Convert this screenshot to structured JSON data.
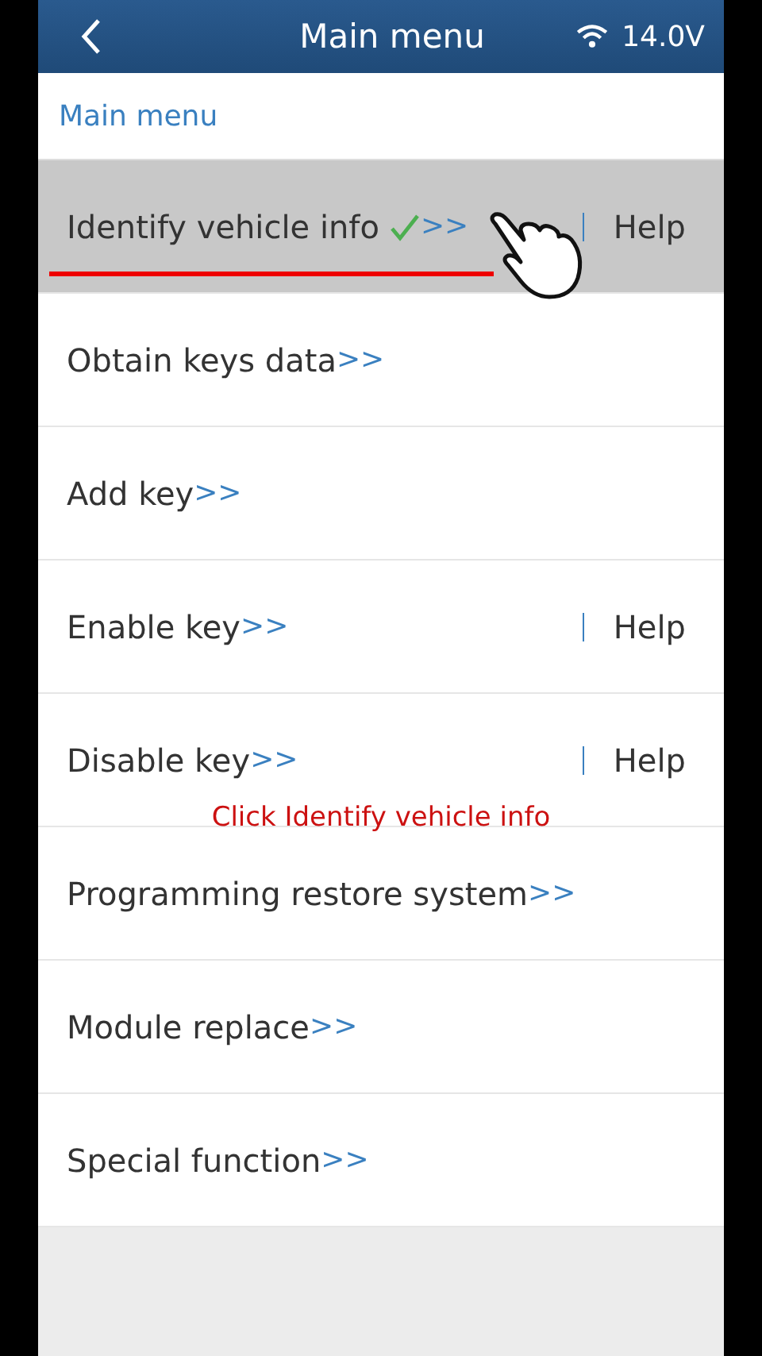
{
  "header": {
    "title": "Main menu",
    "voltage": "14.0V"
  },
  "breadcrumb": "Main menu",
  "items": [
    {
      "label": "Identify vehicle info",
      "arrow": ">>",
      "help": "Help",
      "selected": true,
      "checked": true
    },
    {
      "label": "Obtain keys data",
      "arrow": ">>",
      "selected": false,
      "checked": false
    },
    {
      "label": "Add key",
      "arrow": ">>",
      "selected": false,
      "checked": false
    },
    {
      "label": "Enable key",
      "arrow": ">>",
      "help": "Help",
      "selected": false,
      "checked": false
    },
    {
      "label": "Disable key",
      "arrow": ">>",
      "help": "Help",
      "selected": false,
      "checked": false
    },
    {
      "label": "Programming restore system",
      "arrow": ">>",
      "selected": false,
      "checked": false
    },
    {
      "label": "Module replace",
      "arrow": ">>",
      "selected": false,
      "checked": false
    },
    {
      "label": "Special function",
      "arrow": ">>",
      "selected": false,
      "checked": false
    }
  ],
  "annotation": "Click Identify vehicle info"
}
